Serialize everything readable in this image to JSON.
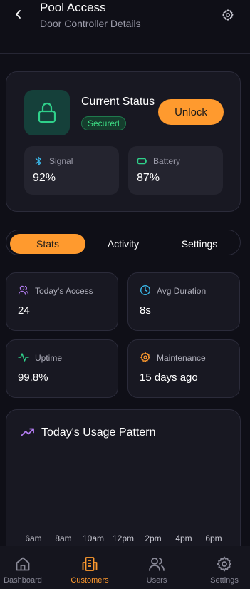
{
  "header": {
    "title": "Pool Access",
    "subtitle": "Door Controller Details",
    "back_icon": "chevron-left-icon",
    "settings_icon": "gear-icon"
  },
  "status": {
    "label": "Current Status",
    "badge": "Secured",
    "unlock_label": "Unlock",
    "signal": {
      "label": "Signal",
      "value": "92%",
      "icon": "bluetooth-icon",
      "color": "#3ab7e8"
    },
    "battery": {
      "label": "Battery",
      "value": "87%",
      "icon": "battery-icon",
      "color": "#2fd08a"
    }
  },
  "tabs": [
    {
      "label": "Stats",
      "active": true
    },
    {
      "label": "Activity",
      "active": false
    },
    {
      "label": "Settings",
      "active": false
    }
  ],
  "stats": [
    {
      "label": "Today's Access",
      "value": "24",
      "icon": "users-icon",
      "color": "#b27cf0"
    },
    {
      "label": "Avg Duration",
      "value": "8s",
      "icon": "clock-icon",
      "color": "#3ab7e8"
    },
    {
      "label": "Uptime",
      "value": "99.8%",
      "icon": "activity-icon",
      "color": "#2fd08a"
    },
    {
      "label": "Maintenance",
      "value": "15 days ago",
      "icon": "gear-icon",
      "color": "#ff9a2e"
    }
  ],
  "usage": {
    "title": "Today's Usage Pattern",
    "icon": "trending-up-icon",
    "icon_color": "#b27cf0",
    "x_labels": [
      "6am",
      "8am",
      "10am",
      "12pm",
      "2pm",
      "4pm",
      "6pm"
    ]
  },
  "nav": [
    {
      "label": "Dashboard",
      "icon": "home-icon",
      "active": false
    },
    {
      "label": "Customers",
      "icon": "building-icon",
      "active": true
    },
    {
      "label": "Users",
      "icon": "users-icon",
      "active": false
    },
    {
      "label": "Settings",
      "icon": "gear-icon",
      "active": false
    }
  ],
  "colors": {
    "accent": "#ff9a2e",
    "background": "#0f0f17",
    "card": "#181822",
    "secured": "#3ddc84"
  }
}
